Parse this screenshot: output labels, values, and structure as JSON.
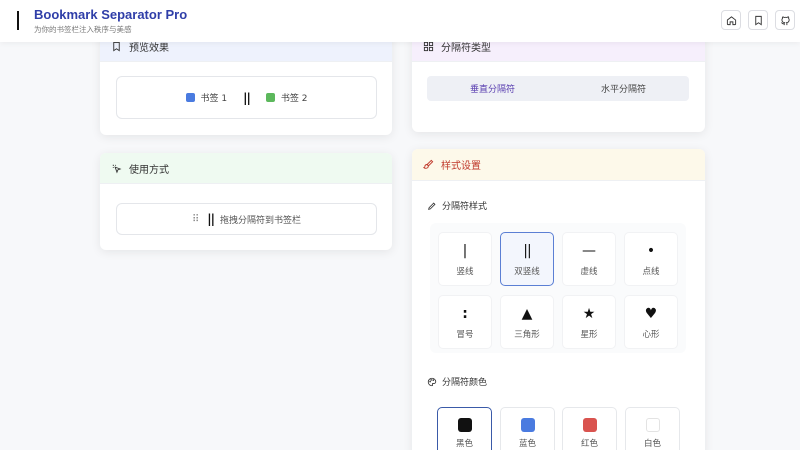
{
  "header": {
    "title": "Bookmark Separator Pro",
    "subtitle": "为你的书签栏注入秩序与美感",
    "buttons": [
      {
        "name": "home-icon"
      },
      {
        "name": "bookmark-icon"
      },
      {
        "name": "github-icon"
      }
    ]
  },
  "preview": {
    "title": "预览效果",
    "bookmark1": "书签 1",
    "bookmark2": "书签 2",
    "separator": "||",
    "colors": {
      "bookmark1": "#4a7be0",
      "bookmark2": "#5cb85c"
    }
  },
  "usage": {
    "title": "使用方式",
    "separator": "||",
    "instruction": "拖拽分隔符到书签栏"
  },
  "type": {
    "title": "分隔符类型",
    "tabs": [
      {
        "label": "垂直分隔符",
        "active": true
      },
      {
        "label": "水平分隔符",
        "active": false
      }
    ]
  },
  "style": {
    "title": "样式设置",
    "symbol_label": "分隔符样式",
    "symbols": [
      {
        "glyph": "|",
        "label": "竖线",
        "selected": false
      },
      {
        "glyph": "||",
        "label": "双竖线",
        "selected": true
      },
      {
        "glyph": "—",
        "label": "虚线",
        "selected": false
      },
      {
        "glyph": "•",
        "label": "点线",
        "selected": false
      },
      {
        "glyph": ":",
        "label": "冒号",
        "selected": false
      },
      {
        "glyph": "▲",
        "label": "三角形",
        "selected": false
      },
      {
        "glyph": "★",
        "label": "星形",
        "selected": false
      },
      {
        "glyph": "♥",
        "label": "心形",
        "selected": false
      }
    ],
    "color_label": "分隔符颜色",
    "colors": [
      {
        "label": "黑色",
        "hex": "#111111",
        "selected": true
      },
      {
        "label": "蓝色",
        "hex": "#4a7be0",
        "selected": false
      },
      {
        "label": "红色",
        "hex": "#d9534f",
        "selected": false
      },
      {
        "label": "白色",
        "hex": "#ffffff",
        "selected": false
      }
    ]
  },
  "theme": {
    "accent": "#2f3ea8",
    "preview_head": "#eef2fd",
    "usage_head": "#effaf1",
    "type_head": "#f6effc",
    "style_head": "#fdf9ea"
  }
}
